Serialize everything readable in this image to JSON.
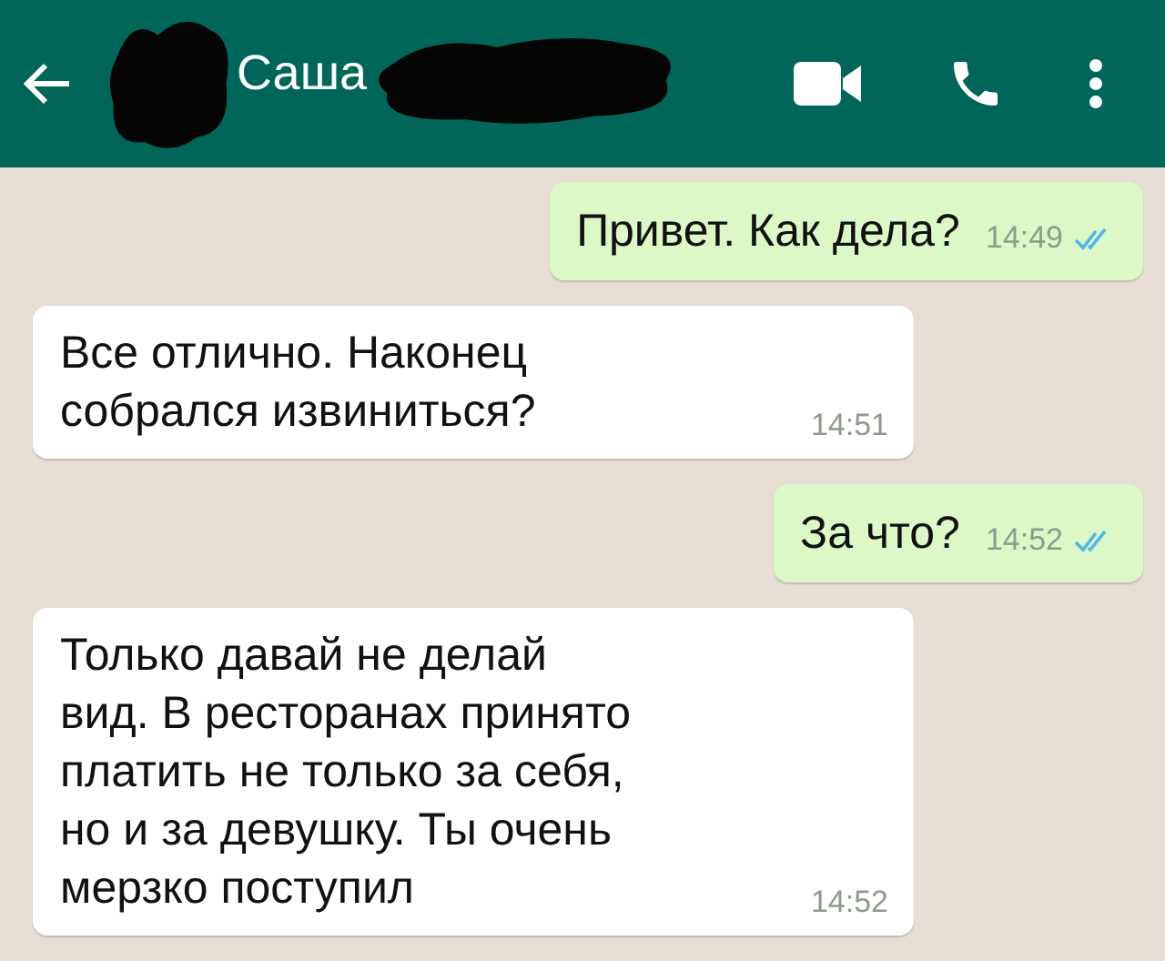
{
  "header": {
    "contact_name": "Саша"
  },
  "messages": [
    {
      "kind": "sent",
      "text": "Привет. Как дела?",
      "time": "14:49",
      "read": true
    },
    {
      "kind": "received",
      "text": "Все отлично. Наконец\nсобрался извиниться?",
      "time": "14:51"
    },
    {
      "kind": "sent",
      "text": "За что?",
      "time": "14:52",
      "read": true
    },
    {
      "kind": "received",
      "text": "Только давай не делай\nвид. В ресторанах принято\nплатить не только за себя,\nно и за девушку. Ты очень\nмерзко поступил",
      "time": "14:52"
    }
  ]
}
